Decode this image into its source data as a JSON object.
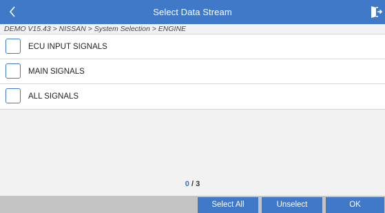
{
  "header": {
    "title": "Select Data Stream",
    "back_icon": "chevron-left-icon",
    "exit_icon": "exit-icon"
  },
  "breadcrumb": "DEMO V15.43 > NISSAN > System Selection > ENGINE",
  "items": [
    {
      "label": "ECU INPUT SIGNALS",
      "checked": false
    },
    {
      "label": "MAIN SIGNALS",
      "checked": false
    },
    {
      "label": "ALL SIGNALS",
      "checked": false
    }
  ],
  "counter": {
    "selected": "0",
    "total": "/ 3"
  },
  "footer": {
    "select_all": "Select All",
    "unselect": "Unselect",
    "ok": "OK"
  },
  "colors": {
    "accent": "#3f79c8",
    "footer_bg": "#c4c4c4",
    "counter_selected": "#2f74d0"
  }
}
